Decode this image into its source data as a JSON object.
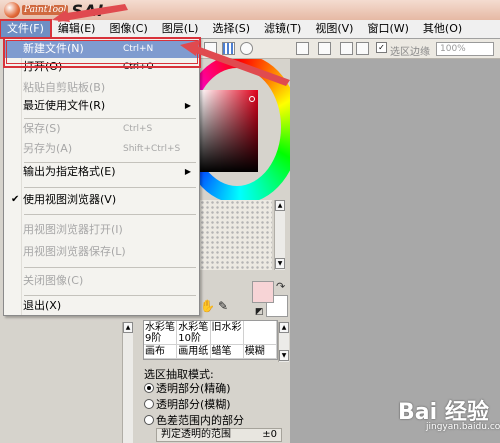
{
  "app": {
    "logo_small": "PaintTool",
    "logo_big": "SAI"
  },
  "menubar": {
    "items": [
      {
        "label": "文件(F)",
        "active": true
      },
      {
        "label": "编辑(E)"
      },
      {
        "label": "图像(C)"
      },
      {
        "label": "图层(L)"
      },
      {
        "label": "选择(S)"
      },
      {
        "label": "滤镜(T)"
      },
      {
        "label": "视图(V)"
      },
      {
        "label": "窗口(W)"
      },
      {
        "label": "其他(O)"
      }
    ]
  },
  "toolbar": {
    "sel_edge_label": "选区边缘",
    "zoom_value": "100%"
  },
  "file_menu": {
    "items": [
      {
        "label": "新建文件(N)",
        "shortcut": "Ctrl+N",
        "hover": true
      },
      {
        "label": "打开(O)",
        "shortcut": "Ctrl+O"
      },
      {
        "label": "粘贴自剪贴板(B)",
        "disabled": true
      },
      {
        "label": "最近使用文件(R)",
        "submenu": true
      },
      {
        "label": "保存(S)",
        "shortcut": "Ctrl+S",
        "disabled": true
      },
      {
        "label": "另存为(A)",
        "shortcut": "Shift+Ctrl+S",
        "disabled": true
      },
      {
        "label": "输出为指定格式(E)",
        "submenu": true
      },
      {
        "label": "使用视图浏览器(V)",
        "checked": true
      },
      {
        "label": "用视图浏览器打开(I)",
        "disabled": true
      },
      {
        "label": "用视图浏览器保存(L)",
        "disabled": true
      },
      {
        "label": "关闭图像(C)",
        "disabled": true
      },
      {
        "label": "退出(X)"
      }
    ]
  },
  "brushes": {
    "row1": [
      {
        "line1": "水彩笔",
        "line2": "9阶"
      },
      {
        "line1": "水彩笔",
        "line2": "10阶"
      },
      {
        "line1": "旧水彩",
        "line2": ""
      },
      {
        "line1": "",
        "line2": ""
      }
    ],
    "row2": [
      "画布",
      "画用纸",
      "蜡笔",
      "模糊"
    ]
  },
  "selection_panel": {
    "title": "选区抽取模式:",
    "options": [
      {
        "label": "透明部分(精确)",
        "selected": true
      },
      {
        "label": "透明部分(模糊)",
        "selected": false
      },
      {
        "label": "色差范围内的部分",
        "selected": false
      }
    ],
    "range_label": "判定透明的范围",
    "range_value": "±0"
  },
  "colors": {
    "main": "#f7d4d6",
    "sub": "#ffffff",
    "highlight_red": "#d8323a",
    "menu_hover": "#7f9bcf"
  },
  "watermark": {
    "main": "Bai 经验",
    "sub": "jingyan.baidu.com"
  }
}
